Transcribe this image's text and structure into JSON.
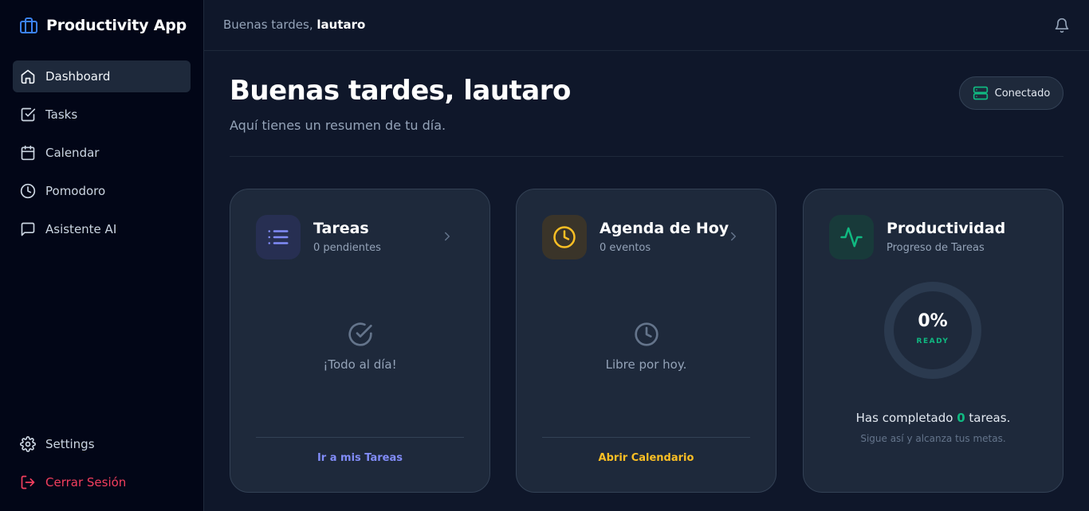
{
  "brand": {
    "title": "Productivity App",
    "icon": "briefcase-icon",
    "accent": "#3b82f6"
  },
  "sidebar": {
    "items": [
      {
        "label": "Dashboard",
        "icon": "home-icon",
        "active": true
      },
      {
        "label": "Tasks",
        "icon": "checkbox-icon"
      },
      {
        "label": "Calendar",
        "icon": "calendar-icon"
      },
      {
        "label": "Pomodoro",
        "icon": "clock-icon"
      },
      {
        "label": "Asistente AI",
        "icon": "chat-icon"
      }
    ],
    "bottom": [
      {
        "label": "Settings",
        "icon": "gear-icon"
      },
      {
        "label": "Cerrar Sesión",
        "icon": "logout-icon",
        "color": "#f43f5e"
      }
    ]
  },
  "topbar": {
    "greeting_prefix": "Buenas tardes,",
    "user": "lautaro"
  },
  "header": {
    "title": "Buenas tardes, lautaro",
    "subtitle": "Aquí tienes un resumen de tu día.",
    "status": "Conectado"
  },
  "cards": {
    "tasks": {
      "title": "Tareas",
      "subtitle": "0 pendientes",
      "empty": "¡Todo al día!",
      "link": "Ir a mis Tareas",
      "accent": "#818cf8"
    },
    "agenda": {
      "title": "Agenda de Hoy",
      "subtitle": "0 eventos",
      "empty": "Libre por hoy.",
      "link": "Abrir Calendario",
      "accent": "#fbbf24"
    },
    "productivity": {
      "title": "Productividad",
      "subtitle": "Progreso de Tareas",
      "progress_value": "0%",
      "progress_fraction": 0,
      "progress_label": "READY",
      "summary_prefix": "Has completado",
      "summary_count": "0",
      "summary_suffix": "tareas.",
      "note": "Sigue así y alcanza tus metas.",
      "accent": "#10b981"
    }
  }
}
